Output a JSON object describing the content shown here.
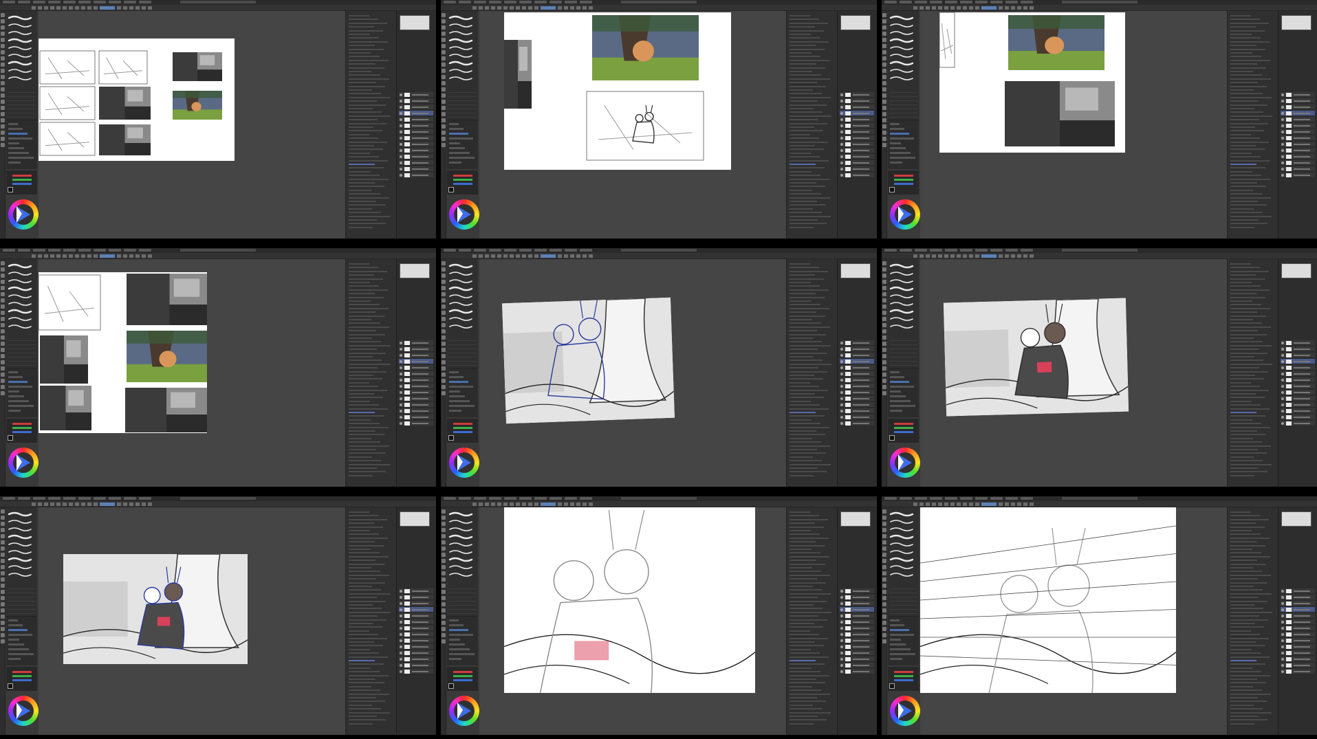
{
  "app": {
    "title": "",
    "accent_color": "#4b6fb0",
    "ui_background": "#3a3a3a"
  },
  "grid": {
    "rows": 3,
    "columns": 3
  },
  "panels": [
    {
      "id": 1,
      "stage": "thumbnail-sketches"
    },
    {
      "id": 2,
      "stage": "color-comp-with-sketch"
    },
    {
      "id": 3,
      "stage": "color-and-value-comps"
    },
    {
      "id": 4,
      "stage": "comp-selection"
    },
    {
      "id": 5,
      "stage": "blue-line-figures"
    },
    {
      "id": 6,
      "stage": "character-refinement"
    },
    {
      "id": 7,
      "stage": "refined-sketch-zoomed-out"
    },
    {
      "id": 8,
      "stage": "zoomed-detail-sketch"
    },
    {
      "id": 9,
      "stage": "perspective-lines"
    }
  ],
  "icons": {
    "color_wheel": "color-wheel-icon",
    "brush_strokes": "brush-preview-icon",
    "layer_eye": "eye-icon"
  }
}
